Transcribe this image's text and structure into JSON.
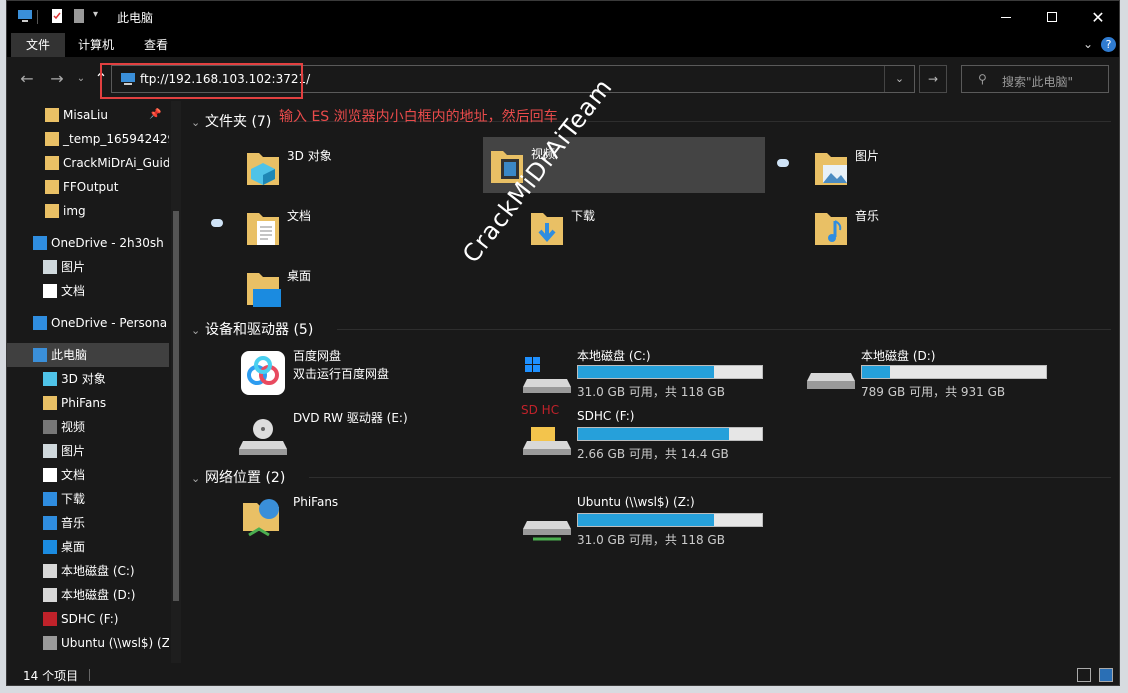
{
  "window": {
    "title": "此电脑"
  },
  "ribbon": {
    "tabs": [
      "文件",
      "计算机",
      "查看"
    ]
  },
  "address": {
    "path": "ftp://192.168.103.102:3721/",
    "search_placeholder": "搜索\"此电脑\""
  },
  "annotation": "输入 ES 浏览器内小白框内的地址，然后回车",
  "sidebar": {
    "items": [
      "MisaLiu",
      "_temp_165942429",
      "CrackMiDrAi_Guid",
      "FFOutput",
      "img",
      "OneDrive - 2h30sh",
      "图片",
      "文档",
      "OneDrive - Persona",
      "此电脑",
      "3D 对象",
      "PhiFans",
      "视频",
      "图片",
      "文档",
      "下载",
      "音乐",
      "桌面",
      "本地磁盘 (C:)",
      "本地磁盘 (D:)",
      "SDHC (F:)",
      "Ubuntu (\\\\wsl$) (Z"
    ]
  },
  "groups": {
    "folders": "文件夹 (7)",
    "devices": "设备和驱动器 (5)",
    "network": "网络位置 (2)"
  },
  "folders": [
    "3D 对象",
    "视频",
    "图片",
    "文档",
    "下载",
    "音乐",
    "桌面"
  ],
  "devices": {
    "baidu": {
      "name": "百度网盘",
      "sub": "双击运行百度网盘"
    },
    "dvd": {
      "name": "DVD RW 驱动器 (E:)"
    },
    "c": {
      "name": "本地磁盘 (C:)",
      "cap": "31.0 GB 可用，共 118 GB",
      "used": 0.74
    },
    "d": {
      "name": "本地磁盘 (D:)",
      "cap": "789 GB 可用，共 931 GB",
      "used": 0.15
    },
    "f": {
      "name": "SDHC (F:)",
      "cap": "2.66 GB 可用，共 14.4 GB",
      "used": 0.82
    }
  },
  "network": {
    "phifans": {
      "name": "PhiFans"
    },
    "ubuntu": {
      "name": "Ubuntu (\\\\wsl$) (Z:)",
      "cap": "31.0 GB 可用，共 118 GB",
      "used": 0.74
    }
  },
  "status": "14 个项目",
  "watermark": "CrackMiDrAiTeam",
  "sd_label": "SD HC"
}
